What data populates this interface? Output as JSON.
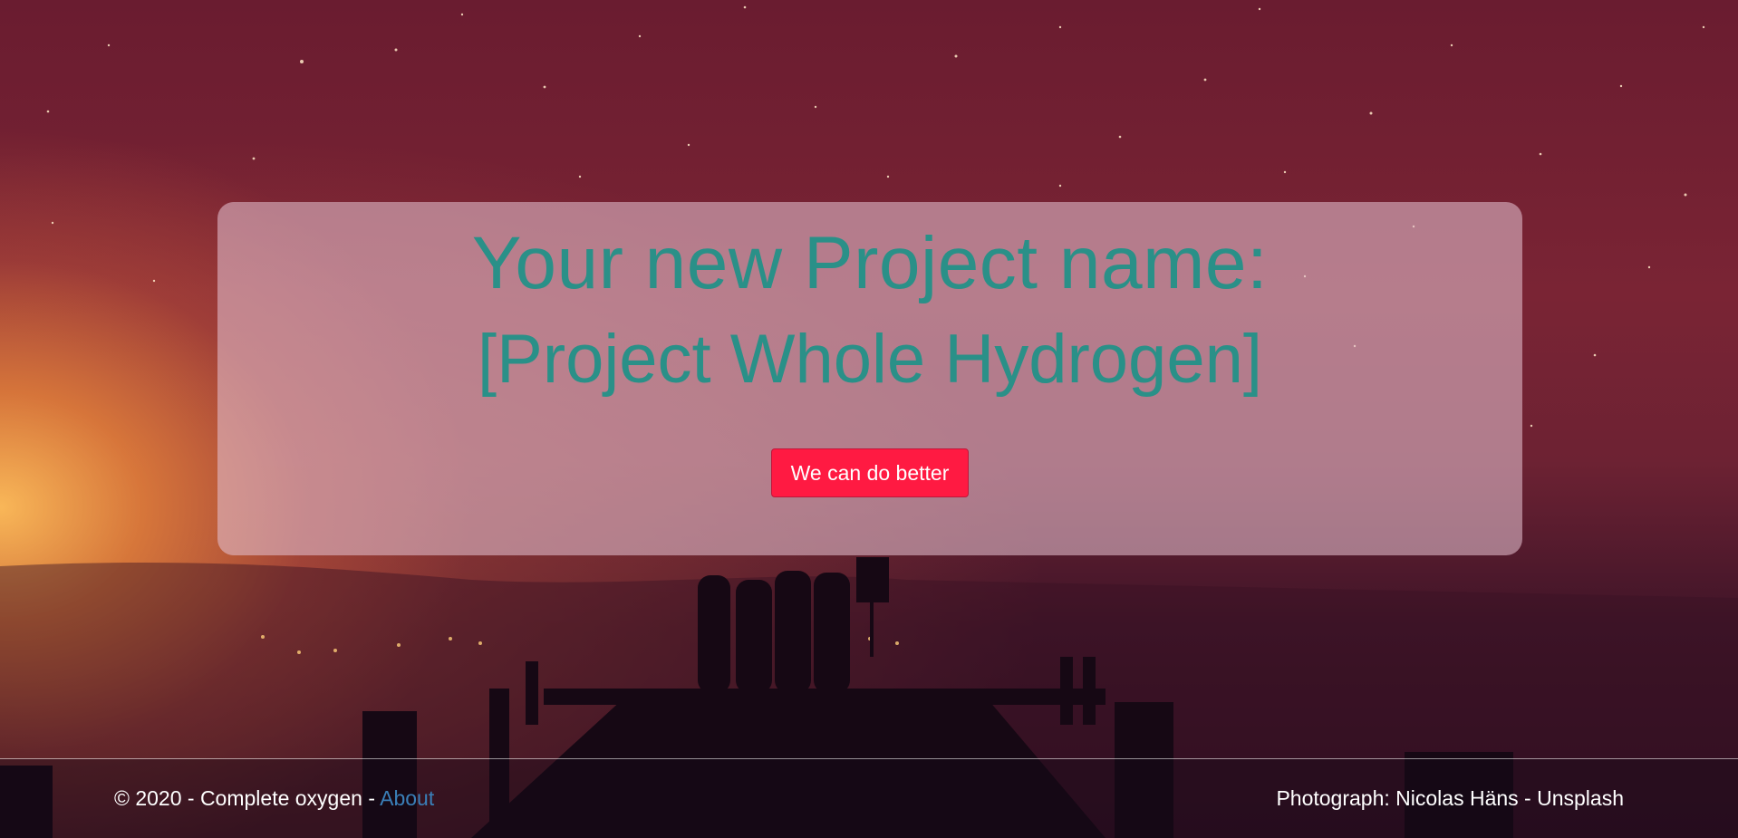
{
  "hero": {
    "title": "Your new Project name:",
    "project_name": "[Project Whole Hydrogen]",
    "button_label": "We can do better"
  },
  "footer": {
    "copyright": "© 2020 - Complete oxygen - ",
    "about_link": "About",
    "photo_credit": "Photograph: Nicolas Häns - Unsplash"
  },
  "colors": {
    "title_text": "#2a9088",
    "button_background": "#ff1a42",
    "link": "#3a7fb8"
  }
}
